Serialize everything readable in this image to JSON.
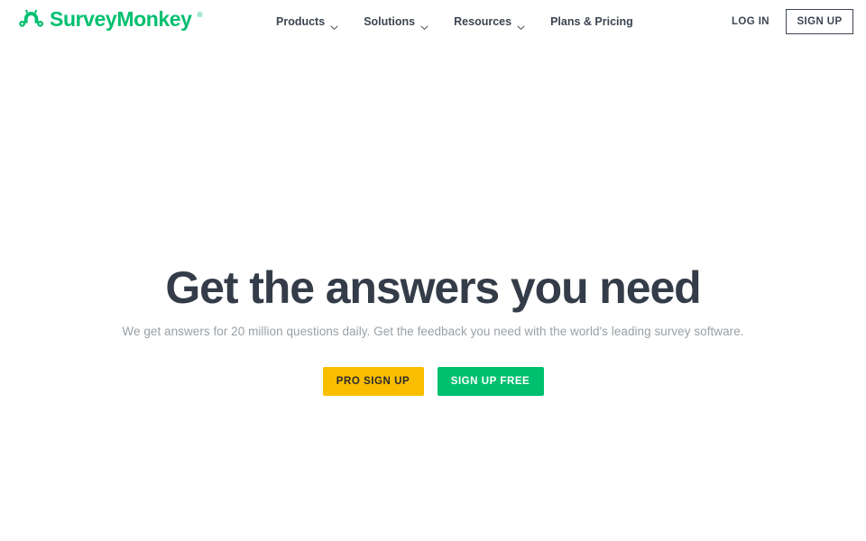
{
  "brand": {
    "name": "SurveyMonkey",
    "trademark": "®",
    "icon": "surveymonkey-monkey-icon",
    "color": "#00bf6f"
  },
  "header": {
    "nav_items": [
      {
        "label": "Products",
        "has_dropdown": true,
        "icon": "chevron-down-icon"
      },
      {
        "label": "Solutions",
        "has_dropdown": true,
        "icon": "chevron-down-icon"
      },
      {
        "label": "Resources",
        "has_dropdown": true,
        "icon": "chevron-down-icon"
      },
      {
        "label": "Plans & Pricing",
        "has_dropdown": false,
        "icon": ""
      }
    ],
    "login_label": "LOG IN",
    "signup_label": "SIGN UP"
  },
  "hero": {
    "title": "Get the answers you need",
    "subtitle": "We get answers for 20 million questions daily. Get the feedback you need with the world's leading survey software.",
    "primary_cta": "PRO SIGN UP",
    "secondary_cta": "SIGN UP FREE",
    "title_color": "#333c48",
    "subtitle_color": "#9aa0a6",
    "primary_cta_color": "#f9be00",
    "secondary_cta_color": "#00bf6f"
  }
}
